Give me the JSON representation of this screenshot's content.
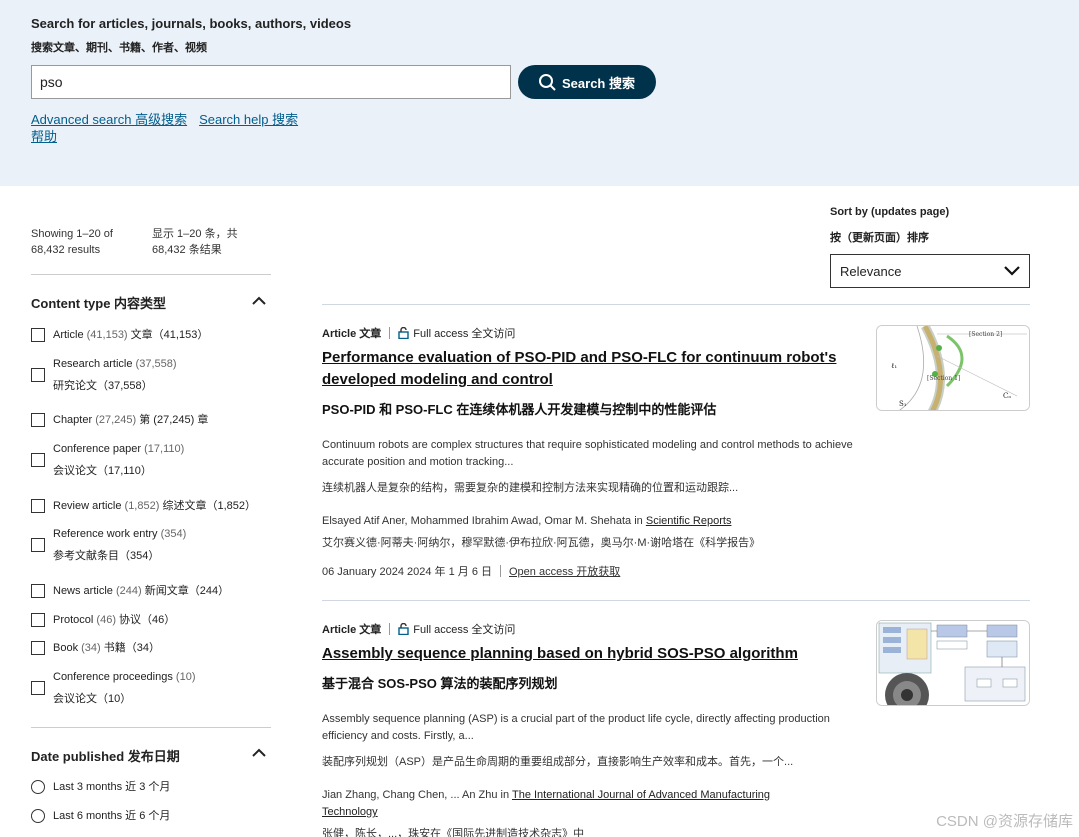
{
  "search": {
    "label_en": "Search for articles, journals, books, authors, videos",
    "label_cn": "搜索文章、期刊、书籍、作者、视频",
    "value": "pso",
    "button": "Search 搜索",
    "advanced": "Advanced search 高级搜索",
    "help": "Search help 搜索帮助"
  },
  "results": {
    "showing_en": "Showing 1–20 of 68,432 results",
    "showing_cn": "显示 1–20 条，共 68,432 条结果"
  },
  "sort": {
    "label_en": "Sort by (updates page)",
    "label_cn": "按（更新页面）排序",
    "selected": "Relevance"
  },
  "content_type": {
    "heading": "Content type 内容类型",
    "items": [
      {
        "label": "Article",
        "count": "(41,153)",
        "cn": "文章（41,153）"
      },
      {
        "label": "Research article",
        "count": "(37,558)",
        "cn": "研究论文（37,558）"
      },
      {
        "label": "Chapter",
        "count": "(27,245)",
        "cn": "第 (27,245) 章"
      },
      {
        "label": "Conference paper",
        "count": "(17,110)",
        "cn": "会议论文（17,110）"
      },
      {
        "label": "Review article",
        "count": "(1,852)",
        "cn": "综述文章（1,852）"
      },
      {
        "label": "Reference work entry",
        "count": "(354)",
        "cn": "参考文献条目（354）"
      },
      {
        "label": "News article",
        "count": "(244)",
        "cn": "新闻文章（244）"
      },
      {
        "label": "Protocol",
        "count": "(46)",
        "cn": "协议（46）"
      },
      {
        "label": "Book",
        "count": "(34)",
        "cn": "书籍（34）"
      },
      {
        "label": "Conference proceedings",
        "count": "(10)",
        "cn": "会议论文（10）"
      }
    ]
  },
  "date_published": {
    "heading": "Date published 发布日期",
    "items": [
      {
        "label": "Last 3 months 近 3 个月"
      },
      {
        "label": "Last 6 months 近 6 个月"
      }
    ]
  },
  "articles": [
    {
      "type": "Article 文章",
      "access": "Full access 全文访问",
      "title": "Performance evaluation of PSO-PID and PSO-FLC for continuum robot's developed modeling and control",
      "title_cn": "PSO-PID 和 PSO-FLC 在连续体机器人开发建模与控制中的性能评估",
      "abstract": "Continuum robots are complex structures that require sophisticated modeling and control methods to achieve accurate position and motion tracking...",
      "abstract_cn": "连续机器人是复杂的结构，需要复杂的建模和控制方法来实现精确的位置和运动跟踪...",
      "authors": "Elsayed Atif Aner, Mohammed Ibrahim Awad, Omar M. Shehata in",
      "journal": "Scientific Reports",
      "authors_cn": "艾尔赛义德·阿蒂夫·阿纳尔，穆罕默德·伊布拉欣·阿瓦德，奥马尔·M·谢哈塔在《科学报告》",
      "date": "06 January 2024 2024 年 1 月 6 日",
      "open_access": "Open access 开放获取"
    },
    {
      "type": "Article 文章",
      "access": "Full access 全文访问",
      "title": "Assembly sequence planning based on hybrid SOS-PSO algorithm",
      "title_cn": "基于混合 SOS-PSO 算法的装配序列规划",
      "abstract": "Assembly sequence planning (ASP) is a crucial part of the product life cycle, directly affecting production efficiency and costs. Firstly, a...",
      "abstract_cn": "装配序列规划（ASP）是产品生命周期的重要组成部分，直接影响生产效率和成本。首先，一个...",
      "authors": "Jian Zhang, Chang Chen, ... An Zhu in",
      "journal": "The International Journal of Advanced Manufacturing Technology",
      "authors_cn": "张健，陈长，...，珠安在《国际先进制造技术杂志》中"
    }
  ],
  "watermark": "CSDN @资源存储库"
}
